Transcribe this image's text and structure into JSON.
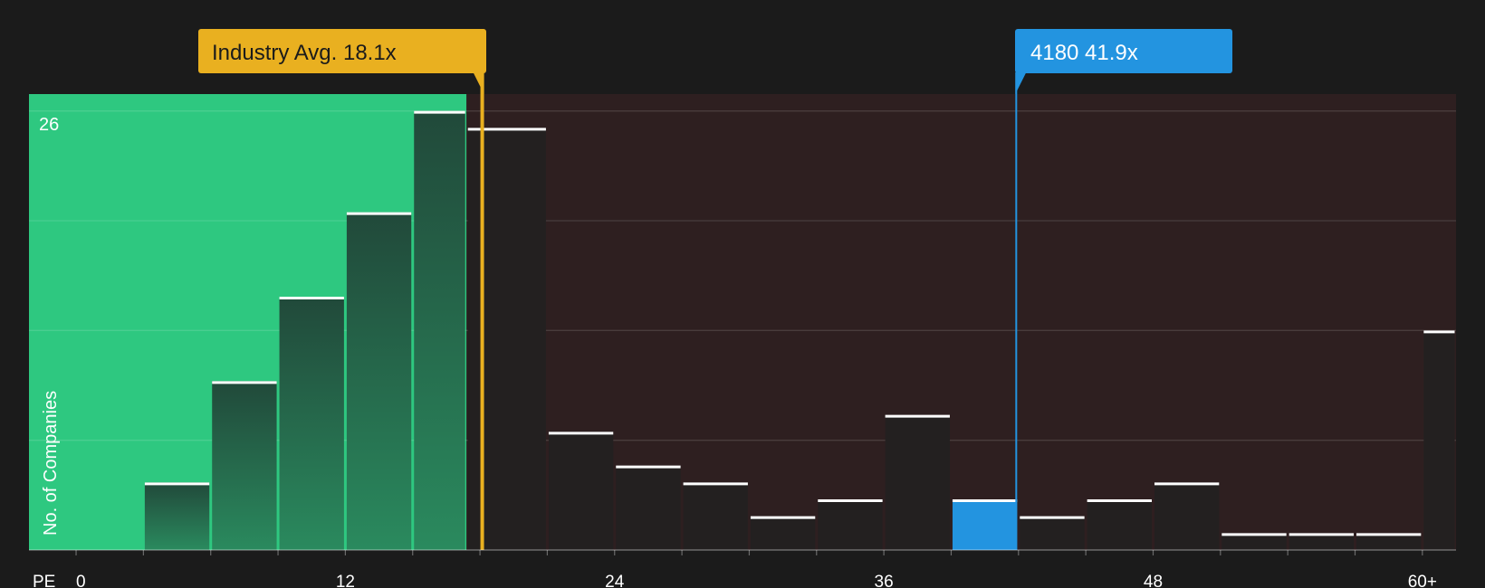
{
  "chart_data": {
    "type": "bar",
    "xlabel": "PE",
    "ylabel": "No. of Companies",
    "y_max_label": "26",
    "x_ticks": [
      "0",
      "12",
      "24",
      "36",
      "48",
      "60+"
    ],
    "x_tick_values": [
      0,
      12,
      24,
      36,
      48,
      60
    ],
    "xlim": [
      -2.1,
      61.5
    ],
    "ylim": [
      0,
      27
    ],
    "grid": true,
    "bins": [
      {
        "start": -2.1,
        "end": 0.9,
        "value": 0
      },
      {
        "start": 3.0,
        "end": 6.0,
        "value": 4
      },
      {
        "start": 6.0,
        "end": 9.0,
        "value": 10
      },
      {
        "start": 9.0,
        "end": 12.0,
        "value": 15
      },
      {
        "start": 12.0,
        "end": 15.0,
        "value": 20
      },
      {
        "start": 15.0,
        "end": 17.4,
        "value": 26
      },
      {
        "start": 17.4,
        "end": 21.0,
        "value": 25
      },
      {
        "start": 21.0,
        "end": 24.0,
        "value": 7
      },
      {
        "start": 24.0,
        "end": 27.0,
        "value": 5
      },
      {
        "start": 27.0,
        "end": 30.0,
        "value": 4
      },
      {
        "start": 30.0,
        "end": 33.0,
        "value": 2
      },
      {
        "start": 33.0,
        "end": 36.0,
        "value": 3
      },
      {
        "start": 36.0,
        "end": 39.0,
        "value": 8
      },
      {
        "start": 39.0,
        "end": 42.0,
        "value": 3,
        "highlight": true
      },
      {
        "start": 42.0,
        "end": 45.0,
        "value": 2
      },
      {
        "start": 45.0,
        "end": 48.0,
        "value": 3
      },
      {
        "start": 48.0,
        "end": 51.0,
        "value": 4
      },
      {
        "start": 51.0,
        "end": 54.0,
        "value": 1
      },
      {
        "start": 54.0,
        "end": 57.0,
        "value": 1
      },
      {
        "start": 57.0,
        "end": 60.0,
        "value": 1
      },
      {
        "start": 60.0,
        "end": 61.5,
        "value": 13
      }
    ],
    "industry_avg": {
      "label": "Industry Avg. 18.1x",
      "value": 18.1
    },
    "company": {
      "label": "4180 41.9x",
      "value": 41.9
    },
    "colors": {
      "background": "#1b1b1b",
      "undervalued_zone": "#2ec880",
      "overvalued_zone": "#2e1f20",
      "bar_in_green": "#1f4a36",
      "bar_in_red": "#232020",
      "highlight_bar": "#2394e0",
      "industry_marker": "#e9b020",
      "company_marker": "#2394e0",
      "bar_cap": "#ffffff",
      "text": "#ffffff"
    }
  }
}
